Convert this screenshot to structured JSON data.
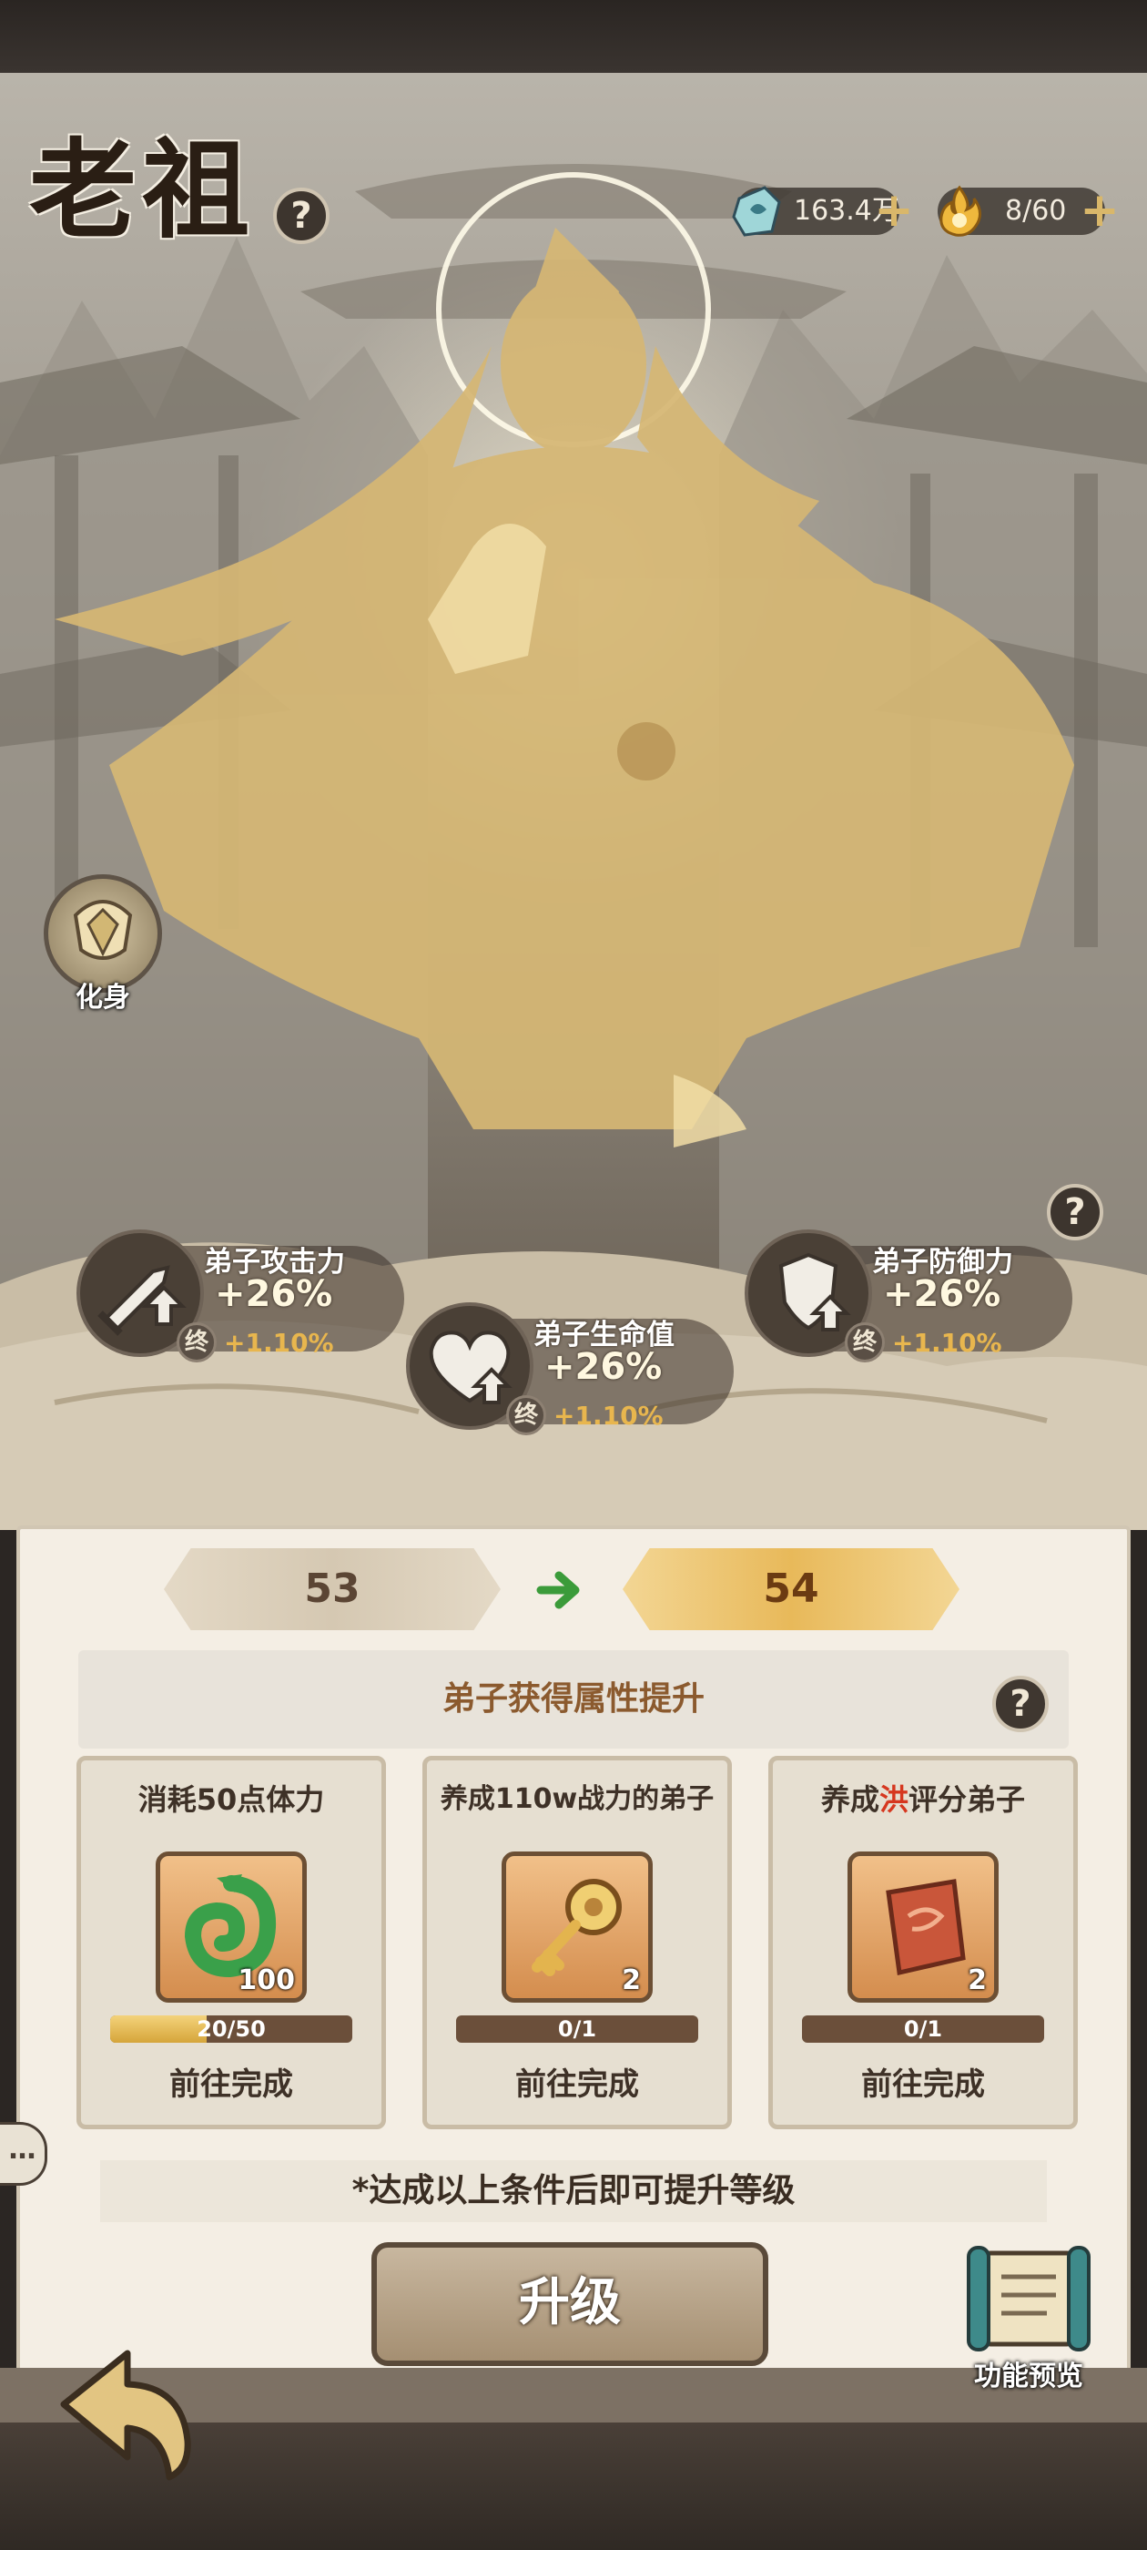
{
  "header": {
    "title": "老祖",
    "help_icon": "?",
    "currency": [
      {
        "icon": "spirit-stone-icon",
        "value": "163.4万"
      },
      {
        "icon": "stamina-flame-icon",
        "value": "8/60"
      }
    ]
  },
  "transform": {
    "label": "化身"
  },
  "stats": [
    {
      "name": "弟子攻击力",
      "value": "+26%",
      "badge": "终",
      "extra": "+1.10%",
      "icon": "sword-up-icon"
    },
    {
      "name": "弟子生命值",
      "value": "+26%",
      "badge": "终",
      "extra": "+1.10%",
      "icon": "heart-up-icon"
    },
    {
      "name": "弟子防御力",
      "value": "+26%",
      "badge": "终",
      "extra": "+1.10%",
      "icon": "shield-up-icon"
    }
  ],
  "level": {
    "current": "53",
    "next": "54"
  },
  "attr_header": "弟子获得属性提升",
  "tasks": [
    {
      "title": "消耗50点体力",
      "title_pre": "消耗50点体力",
      "title_hl": "",
      "title_post": "",
      "item": "jade-dragon-icon",
      "qty": "100",
      "progress_text": "20/50",
      "progress": 0.4,
      "action": "前往完成"
    },
    {
      "title": "养成110w战力的弟子",
      "title_pre": "养成110w战力的弟子",
      "title_hl": "",
      "title_post": "",
      "item": "golden-key-icon",
      "qty": "2",
      "progress_text": "0/1",
      "progress": 0,
      "action": "前往完成"
    },
    {
      "title": "养成洪评分弟子",
      "title_pre": "养成",
      "title_hl": "洪",
      "title_post": "评分弟子",
      "item": "red-scroll-icon",
      "qty": "2",
      "progress_text": "0/1",
      "progress": 0,
      "action": "前往完成"
    }
  ],
  "hint": "*达成以上条件后即可提升等级",
  "upgrade_button": "升级",
  "preview_button": "功能预览",
  "chat_tab": "…"
}
